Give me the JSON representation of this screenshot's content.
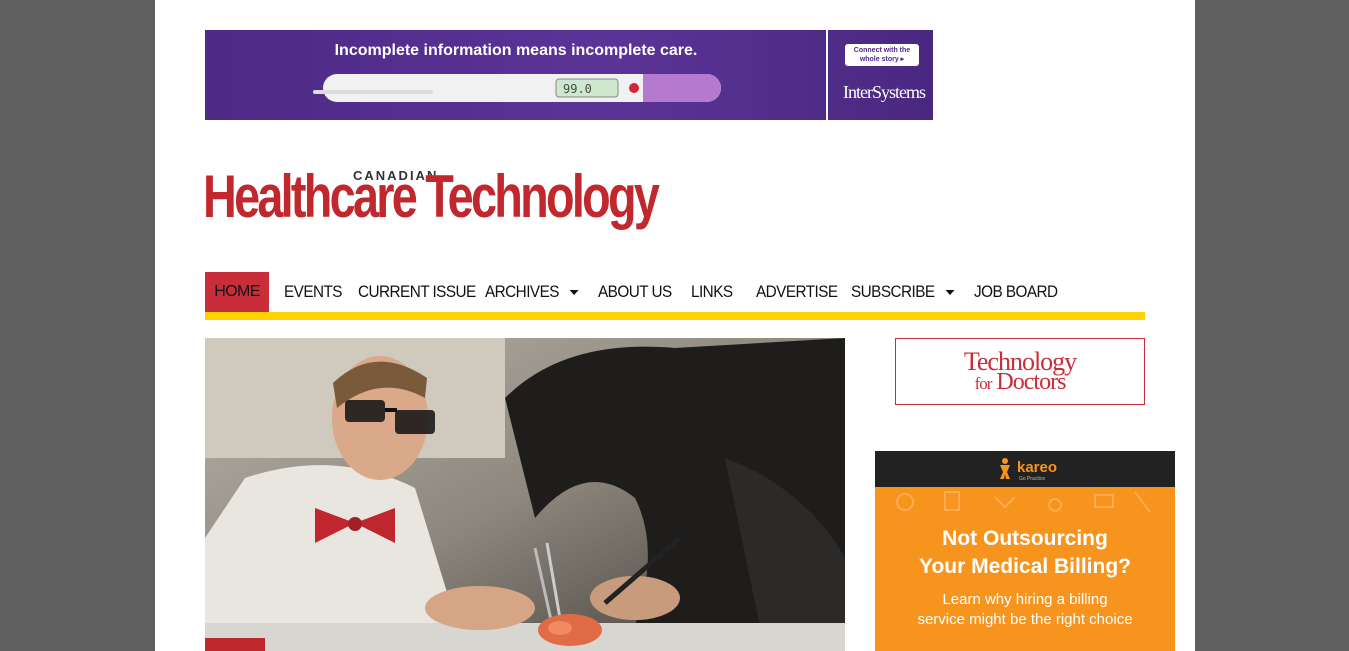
{
  "top_ad": {
    "headline": "Incomplete information means incomplete care.",
    "connect_line1": "Connect with the",
    "connect_line2": "whole story ▸",
    "brand": "InterSystems",
    "thermometer_reading": "99.0"
  },
  "logo": {
    "small": "CANADIAN",
    "name": "Healthcare Technology"
  },
  "nav": {
    "items": [
      {
        "label": "HOME",
        "active": true
      },
      {
        "label": "EVENTS"
      },
      {
        "label": "CURRENT ISSUE"
      },
      {
        "label": "ARCHIVES",
        "dropdown": true
      },
      {
        "label": "ABOUT US"
      },
      {
        "label": "LINKS"
      },
      {
        "label": "ADVERTISE"
      },
      {
        "label": "SUBSCRIBE",
        "dropdown": true
      },
      {
        "label": "JOB BOARD"
      }
    ]
  },
  "sidebar": {
    "tfd_line1": "Technology",
    "tfd_line2_small": "for",
    "tfd_line2": "Doctors",
    "kareo": {
      "brand": "kareo",
      "brand_sub": "Go Practice",
      "headline1": "Not Outsourcing",
      "headline2": "Your Medical Billing?",
      "sub1": "Learn why hiring a billing",
      "sub2": "service might be the right choice"
    }
  },
  "colors": {
    "brand_red": "#c92d39",
    "nav_rule": "#ffd200",
    "ad_purple": "#4d2a86",
    "kareo_orange": "#f7941d"
  }
}
